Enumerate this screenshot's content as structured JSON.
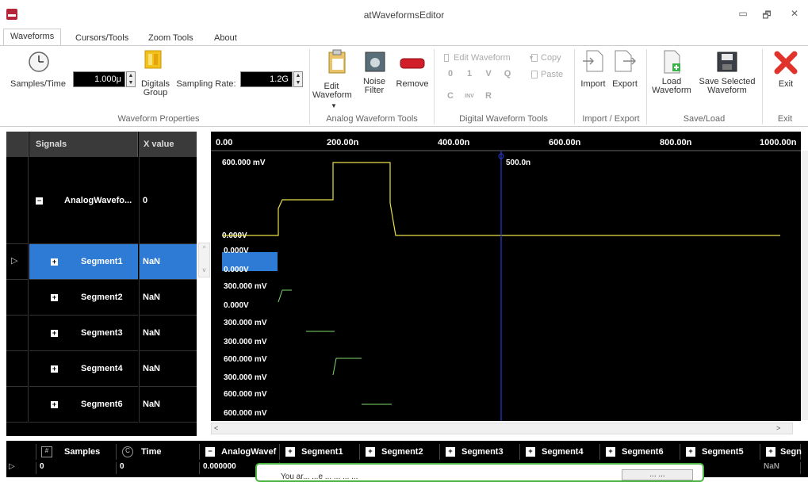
{
  "window": {
    "title": "atWaveformsEditor",
    "minimize": "▭",
    "restore": "🗗",
    "close": "✕"
  },
  "tabs": [
    "Waveforms",
    "Cursors/Tools",
    "Zoom Tools",
    "About"
  ],
  "ribbon": {
    "samples_time_label": "Samples/Time",
    "samples_time_value": "1.000μ",
    "digitals_group_label": "Digitals Group",
    "sampling_rate_label": "Sampling Rate:",
    "sampling_rate_value": "1.2G",
    "waveform_properties_title": "Waveform Properties",
    "edit_waveform": "Edit Waveform",
    "noise_filter": "Noise Filter",
    "remove": "Remove",
    "analog_tools_title": "Analog Waveform Tools",
    "edit_waveform_digital": "Edit Waveform",
    "copy": "Copy",
    "paste": "Paste",
    "digital_tools_title": "Digital Waveform Tools",
    "digital_glyphs": [
      "0",
      "1",
      "V",
      "Q",
      "C",
      "INV",
      "R"
    ],
    "import": "Import",
    "export": "Export",
    "import_export_title": "Import / Export",
    "load_waveform": "Load Waveform",
    "save_selected_waveform": "Save Selected Waveform",
    "save_load_title": "Save/Load",
    "exit": "Exit",
    "exit_title": "Exit"
  },
  "signals": {
    "header_signals": "Signals",
    "header_x": "X value",
    "rows": [
      {
        "name": "AnalogWavefo...",
        "x": "0"
      },
      {
        "name": "Segment1",
        "x": "NaN"
      },
      {
        "name": "Segment2",
        "x": "NaN"
      },
      {
        "name": "Segment3",
        "x": "NaN"
      },
      {
        "name": "Segment4",
        "x": "NaN"
      },
      {
        "name": "Segment6",
        "x": "NaN"
      }
    ]
  },
  "plot": {
    "axis_ticks": [
      "0.00",
      "200.00n",
      "400.00n",
      "600.00n",
      "800.00n",
      "1000.00n"
    ],
    "cursor_label": "500.0n",
    "lane_labels": [
      [
        "600.000 mV",
        "0.000V"
      ],
      [
        "0.000V",
        "0.000V"
      ],
      [
        "300.000 mV",
        "0.000V"
      ],
      [
        "300.000 mV",
        "300.000 mV"
      ],
      [
        "600.000 mV",
        "300.000 mV"
      ],
      [
        "600.000 mV",
        "600.000 mV"
      ]
    ],
    "trace_yellow": "#e8e04a",
    "trace_green": "#7ddc6b",
    "cursor_color": "#2a3bd6"
  },
  "bottom": {
    "headers": [
      "Samples",
      "Time",
      "AnalogWavef",
      "Segment1",
      "Segment2",
      "Segment3",
      "Segment4",
      "Segment6",
      "Segment5",
      "Segn"
    ],
    "values": [
      "0",
      "0",
      "0.000000",
      "",
      "",
      "",
      "",
      "",
      "",
      "NaN"
    ]
  },
  "toast": {
    "text": "You ar... ...e ... ... ... ...",
    "button": "... ..."
  }
}
